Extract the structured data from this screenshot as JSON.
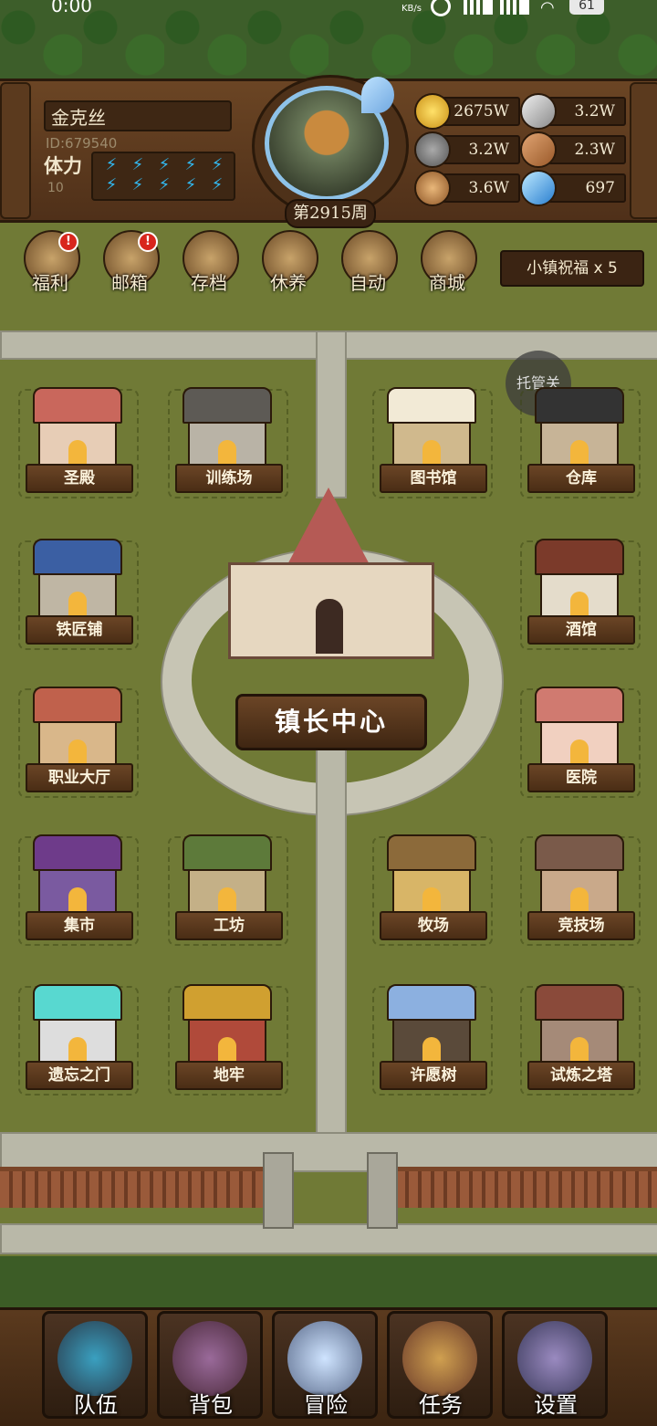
{
  "status_bar": {
    "time": "0:00",
    "net_unit": "KB/s",
    "battery": "61"
  },
  "player": {
    "name": "金克丝",
    "id": "ID:679540",
    "stamina_label": "体力",
    "stamina_value": "10",
    "stamina_bolts": 10
  },
  "week": "第2915周",
  "resources": [
    {
      "icon": "gold-coin-icon",
      "value": "2675W"
    },
    {
      "icon": "iron-ingot-icon",
      "value": "3.2W"
    },
    {
      "icon": "stone-ore-icon",
      "value": "3.2W"
    },
    {
      "icon": "leather-icon",
      "value": "2.3W"
    },
    {
      "icon": "wood-log-icon",
      "value": "3.6W"
    },
    {
      "icon": "blue-crystal-icon",
      "value": "697"
    }
  ],
  "menu": [
    {
      "label": "福利",
      "badge": "!"
    },
    {
      "label": "邮箱",
      "badge": "!"
    },
    {
      "label": "存档",
      "badge": ""
    },
    {
      "label": "休养",
      "badge": ""
    },
    {
      "label": "自动",
      "badge": ""
    },
    {
      "label": "商城",
      "badge": ""
    }
  ],
  "blessing": "小镇祝福 x 5",
  "auto_manage": "托管关",
  "buildings": {
    "shengdian": "圣殿",
    "xunlianchang": "训练场",
    "tushuguan": "图书馆",
    "cangku": "仓库",
    "tiejiangpu": "铁匠铺",
    "jiuguan": "酒馆",
    "zhiyedating": "职业大厅",
    "yiyuan": "医院",
    "jishi": "集市",
    "gongfang": "工坊",
    "muchang": "牧场",
    "jingjichang": "竞技场",
    "yiwangzhimen": "遗忘之门",
    "dilao": "地牢",
    "xuyuanshu": "许愿树",
    "shilianzhita": "试炼之塔",
    "center": "镇长中心"
  },
  "nav": [
    "队伍",
    "背包",
    "冒险",
    "任务",
    "设置"
  ],
  "colors": {
    "accent_blue": "#32b9f2",
    "badge_red": "#d8261d",
    "wood": "#5b3a1e"
  }
}
